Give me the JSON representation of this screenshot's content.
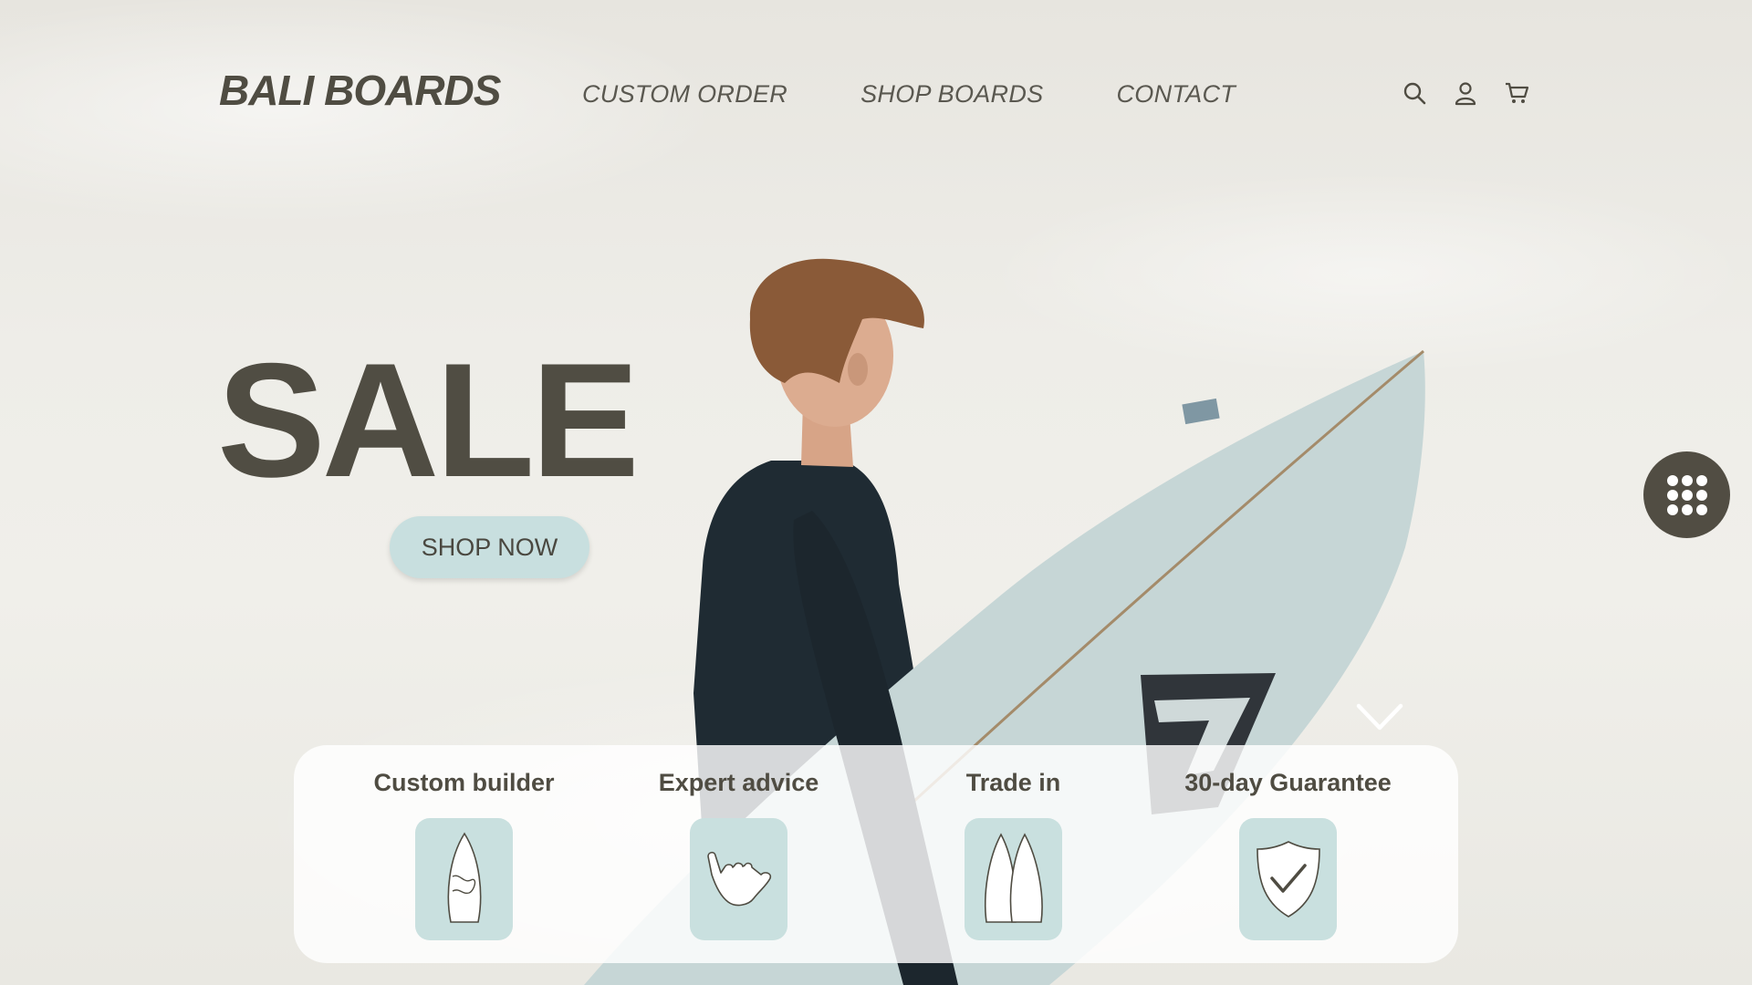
{
  "brand": {
    "logo": "BALI BOARDS"
  },
  "nav": {
    "items": [
      "CUSTOM ORDER",
      "SHOP BOARDS",
      "CONTACT"
    ]
  },
  "header_icons": [
    "search-icon",
    "user-icon",
    "cart-icon"
  ],
  "hero": {
    "headline": "SALE",
    "cta_label": "SHOP NOW",
    "image": "surfer-holding-surfboard-photo"
  },
  "floating_button": {
    "icon": "grid-icon"
  },
  "scroll_indicator": {
    "icon": "chevron-down-icon"
  },
  "features": [
    {
      "title": "Custom builder",
      "icon": "surfboard-design-icon"
    },
    {
      "title": "Expert advice",
      "icon": "shaka-hand-icon"
    },
    {
      "title": "Trade in",
      "icon": "two-surfboards-icon"
    },
    {
      "title": "30-day Guarantee",
      "icon": "shield-check-icon"
    }
  ],
  "colors": {
    "text_dark": "#504d43",
    "accent_teal": "#c8dfdf",
    "floating_button": "#514d43",
    "card_background": "#ffffff"
  }
}
